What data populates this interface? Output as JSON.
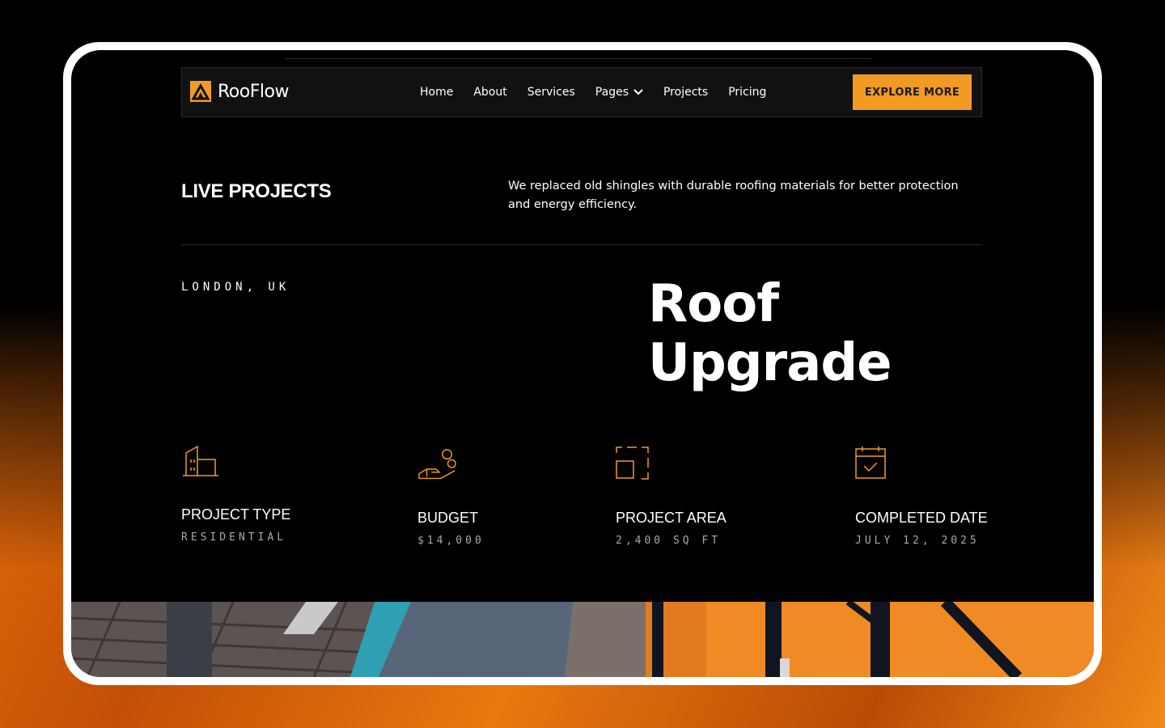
{
  "brand": {
    "name": "RooFlow",
    "accent": "#f39a25"
  },
  "nav": {
    "items": [
      {
        "label": "Home"
      },
      {
        "label": "About"
      },
      {
        "label": "Services"
      },
      {
        "label": "Pages",
        "dropdown": true
      },
      {
        "label": "Projects"
      },
      {
        "label": "Pricing"
      }
    ],
    "cta_label": "EXPLORE MORE"
  },
  "intro": {
    "title": "LIVE PROJECTS",
    "description": "We replaced old shingles with durable roofing materials for better protection and energy efficiency."
  },
  "project": {
    "location": "LONDON, UK",
    "title_line1": "Roof",
    "title_line2": "Upgrade"
  },
  "stats": [
    {
      "icon": "building-icon",
      "label": "PROJECT TYPE",
      "value": "RESIDENTIAL"
    },
    {
      "icon": "budget-hand-coins-icon",
      "label": "BUDGET",
      "value": "$14,000"
    },
    {
      "icon": "area-frame-icon",
      "label": "PROJECT AREA",
      "value": "2,400 SQ FT"
    },
    {
      "icon": "calendar-check-icon",
      "label": "COMPLETED DATE",
      "value": "JULY 12, 2025"
    }
  ]
}
